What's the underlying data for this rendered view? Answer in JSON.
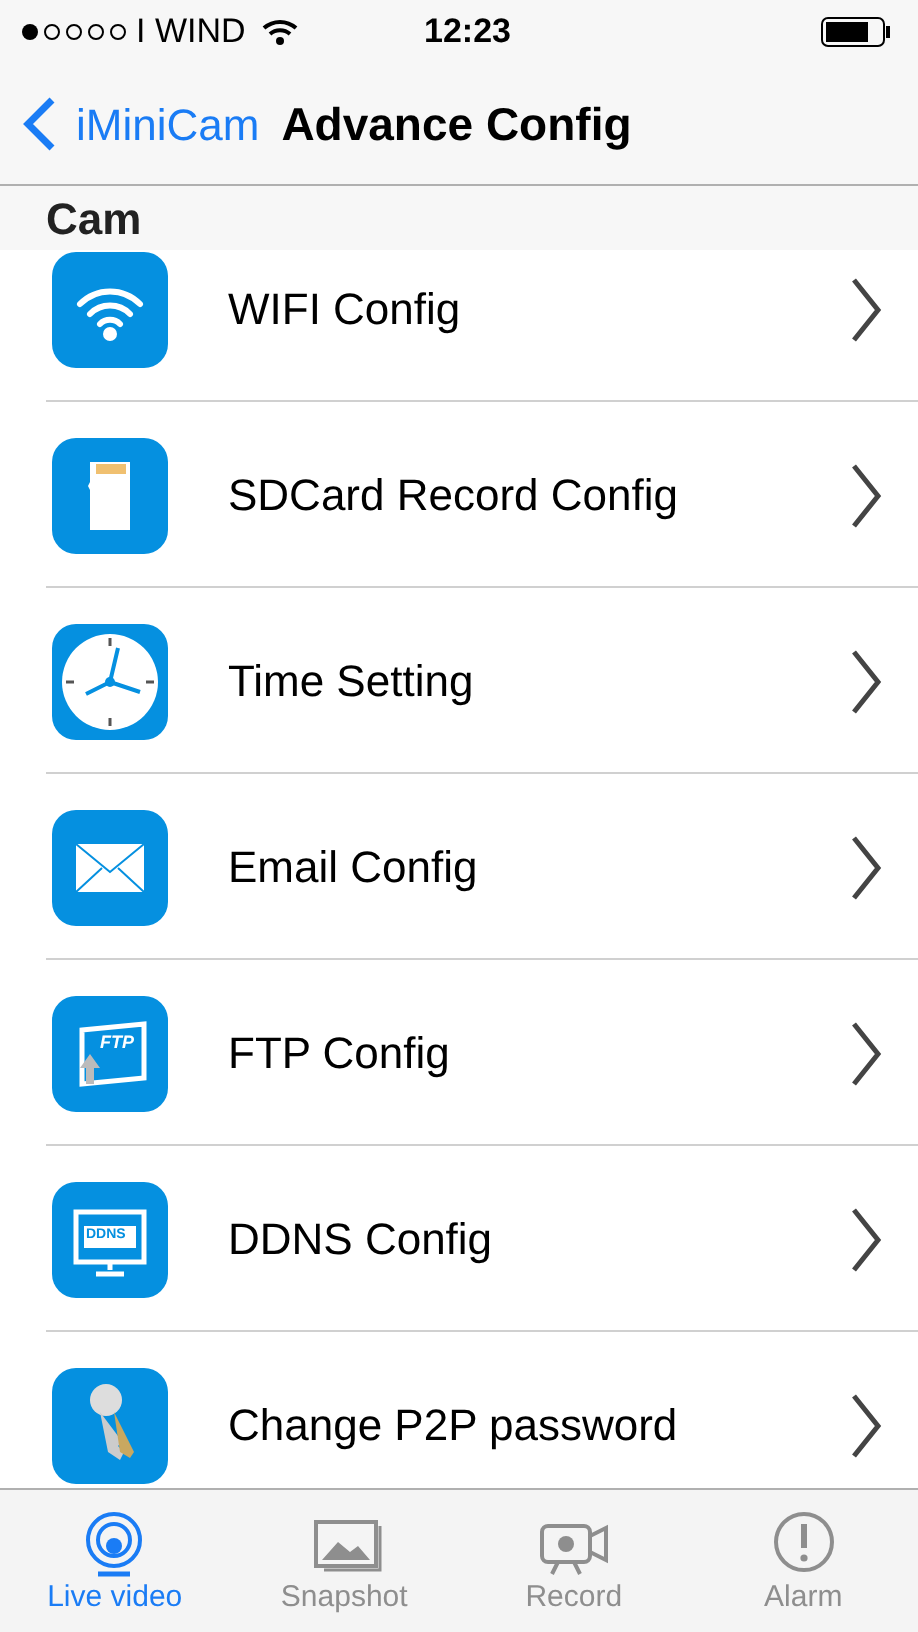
{
  "status_bar": {
    "carrier": "I WIND",
    "time": "12:23"
  },
  "nav": {
    "back": "iMiniCam",
    "title": "Advance Config"
  },
  "section": "Cam",
  "rows": [
    {
      "kind": "wifi",
      "label": "WIFI Config"
    },
    {
      "kind": "sdcard",
      "label": "SDCard Record Config"
    },
    {
      "kind": "clock",
      "label": "Time Setting"
    },
    {
      "kind": "email",
      "label": "Email Config"
    },
    {
      "kind": "ftp",
      "label": "FTP Config",
      "icon_text": "FTP"
    },
    {
      "kind": "ddns",
      "label": "DDNS Config",
      "icon_text": "DDNS"
    },
    {
      "kind": "key",
      "label": "Change P2P password"
    }
  ],
  "tabs": [
    {
      "kind": "live",
      "label": "Live video",
      "selected": true
    },
    {
      "kind": "snapshot",
      "label": "Snapshot",
      "selected": false
    },
    {
      "kind": "record",
      "label": "Record",
      "selected": false
    },
    {
      "kind": "alarm",
      "label": "Alarm",
      "selected": false
    }
  ]
}
